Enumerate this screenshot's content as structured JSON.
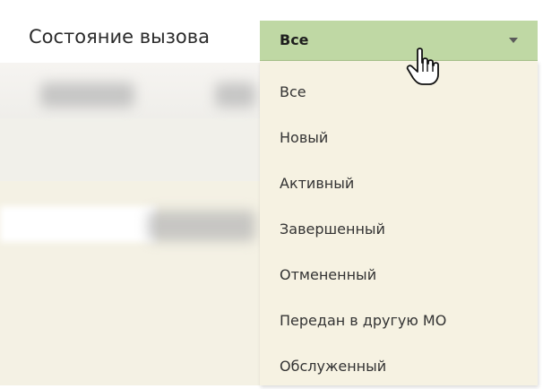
{
  "field": {
    "label": "Состояние вызова",
    "selected": "Все"
  },
  "dropdown": {
    "options": [
      "Все",
      "Новый",
      "Активный",
      "Завершенный",
      "Отмененный",
      "Передан в другую МО",
      "Обслуженный"
    ]
  },
  "colors": {
    "select_header": "#bfd8a4",
    "dropdown_background": "#f6f2e2"
  },
  "icons": {
    "caret": "chevron-down-icon",
    "cursor": "hand-pointer-icon"
  }
}
